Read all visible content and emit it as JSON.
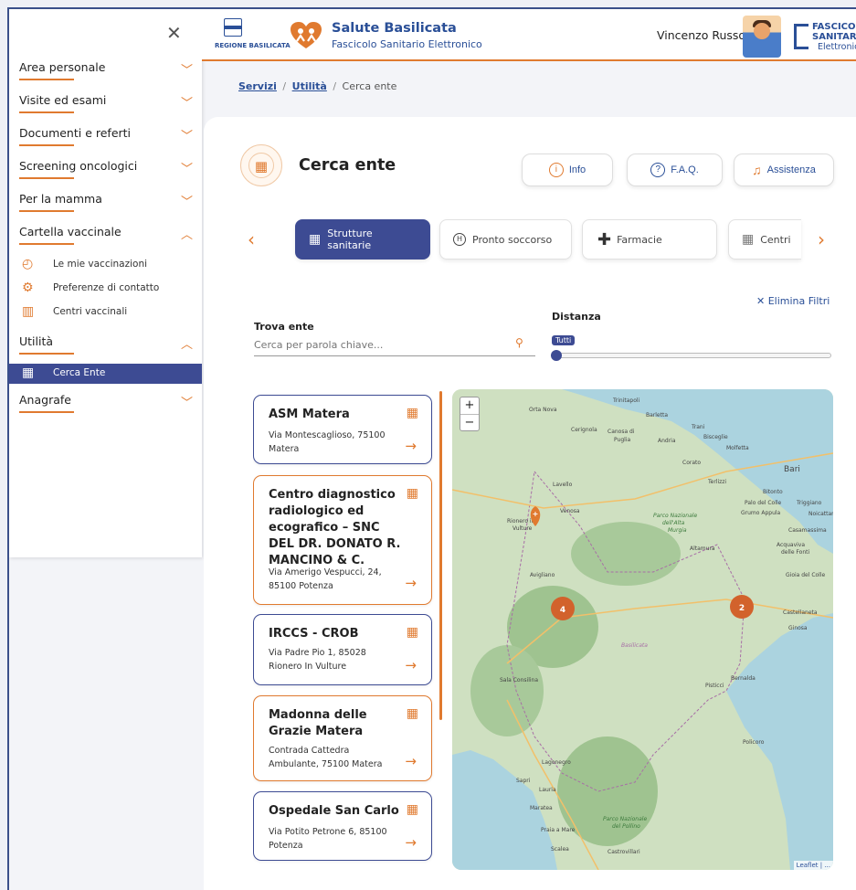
{
  "sidebar": {
    "menu": [
      {
        "label": "Area personale",
        "open": false
      },
      {
        "label": "Visite ed esami",
        "open": false
      },
      {
        "label": "Documenti e referti",
        "open": false
      },
      {
        "label": "Screening oncologici",
        "open": false
      },
      {
        "label": "Per la mamma",
        "open": false
      },
      {
        "label": "Cartella vaccinale",
        "open": true
      }
    ],
    "vaccine_sub": [
      {
        "label": "Le mie vaccinazioni",
        "icon": "syringe-icon"
      },
      {
        "label": "Preferenze di contatto",
        "icon": "gear-icon"
      },
      {
        "label": "Centri vaccinali",
        "icon": "map-icon"
      }
    ],
    "utility": {
      "label": "Utilità",
      "open": true
    },
    "utility_sub": [
      {
        "label": "Cerca Ente",
        "icon": "building-icon",
        "active": true
      }
    ],
    "anagrafe": {
      "label": "Anagrafe",
      "open": false
    }
  },
  "header": {
    "region_label": "REGIONE BASILICATA",
    "app_title": "Salute Basilicata",
    "app_subtitle": "Fascicolo Sanitario Elettronico",
    "user_name": "Vincenzo Russo",
    "fse_logo": [
      "FASCICOLO",
      "SANITARIO",
      "Elettronico"
    ]
  },
  "breadcrumb": {
    "items": [
      "Servizi",
      "Utilità"
    ],
    "current": "Cerca ente",
    "separator": "/"
  },
  "page": {
    "title": "Cerca ente",
    "buttons": {
      "info": "Info",
      "faq": "F.A.Q.",
      "assist": "Assistenza"
    },
    "tabs": [
      {
        "label": "Strutture sanitarie",
        "active": true
      },
      {
        "label": "Pronto soccorso",
        "active": false
      },
      {
        "label": "Farmacie",
        "active": false
      },
      {
        "label": "Centri",
        "active": false
      }
    ],
    "clear_filters": "Elimina Filtri",
    "find_label": "Trova ente",
    "search_placeholder": "Cerca per parola chiave...",
    "distance_label": "Distanza",
    "distance_value": "Tutti"
  },
  "entities": [
    {
      "name": "ASM Matera",
      "address": "Via Montescaglioso, 75100 Matera",
      "border": "blue"
    },
    {
      "name": "Centro diagnostico radiologico ed ecografico – SNC DEL DR. DONATO R. MANCINO & C.",
      "address": "Via Amerigo Vespucci, 24, 85100 Potenza",
      "border": "orange"
    },
    {
      "name": "IRCCS - CROB",
      "address": "Via Padre Pio 1, 85028 Rionero In Vulture",
      "border": "blue"
    },
    {
      "name": "Madonna delle Grazie Matera",
      "address": "Contrada Cattedra Ambulante, 75100 Matera",
      "border": "orange"
    },
    {
      "name": "Ospedale San Carlo",
      "address": "Via Potito Petrone 6, 85100 Potenza",
      "border": "blue"
    }
  ],
  "map": {
    "attribution": "Leaflet | ...",
    "clusters": [
      "4",
      "2"
    ],
    "places": [
      "Orta Nova",
      "Trinitapoli",
      "Barletta",
      "Trani",
      "Cerignola",
      "Canosa di Puglia",
      "Andria",
      "Bisceglie",
      "Molfetta",
      "Corato",
      "Terlizzi",
      "Bari",
      "Bitonto",
      "Palo del Colle",
      "Triggiano",
      "Grumo Appula",
      "Noicattaro",
      "Lavello",
      "Venosa",
      "Rionero in Vulture",
      "Parco Nazionale dell'Alta Murgia",
      "Casamassima",
      "Acquaviva delle Fonti",
      "Altamura",
      "Gioia del Colle",
      "Avigliano",
      "Castellaneta",
      "Ginosa",
      "Basilicata",
      "Sala Consilina",
      "Bernalda",
      "Pisticci",
      "Policoro",
      "Lagonegro",
      "Sapri",
      "Lauria",
      "Maratea",
      "Parco Nazionale del Pollino",
      "Praia a Mare",
      "Scalea",
      "Castrovillari"
    ]
  },
  "colors": {
    "primary": "#3d4b93",
    "accent": "#e07a2f",
    "brand_text": "#2a4f97"
  }
}
